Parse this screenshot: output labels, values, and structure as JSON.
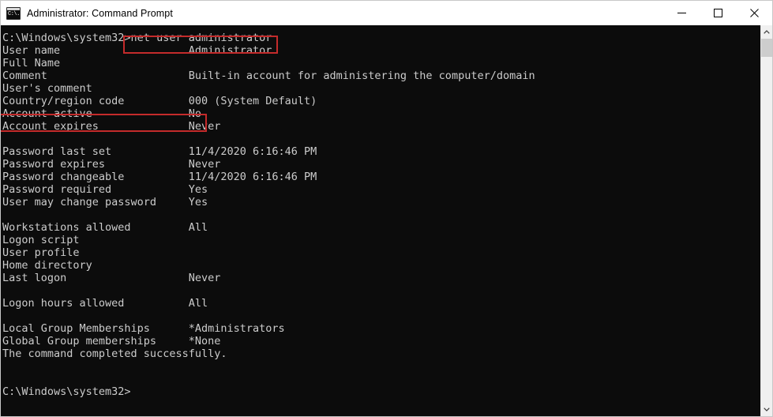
{
  "window": {
    "title": "Administrator: Command Prompt",
    "icon": "command-prompt-icon",
    "icon_glyph": "C:\\.",
    "controls": {
      "minimize": "Minimize",
      "maximize": "Maximize",
      "close": "Close"
    }
  },
  "colors": {
    "terminal_background": "#0c0c0c",
    "terminal_text": "#cccccc",
    "titlebar_background": "#ffffff",
    "titlebar_text": "#000000",
    "annotation_red": "#c42b2b",
    "scrollbar_track": "#f0f0f0",
    "scrollbar_thumb": "#cdcdcd"
  },
  "terminal": {
    "prompt_path": "C:\\Windows\\system32>",
    "command": "net user administrator",
    "output_text": "C:\\Windows\\system32>net user administrator\nUser name                    Administrator\nFull Name\nComment                      Built-in account for administering the computer/domain\nUser's comment\nCountry/region code          000 (System Default)\nAccount active               No\nAccount expires              Never\n\nPassword last set            11/4/2020 6:16:46 PM\nPassword expires             Never\nPassword changeable          11/4/2020 6:16:46 PM\nPassword required            Yes\nUser may change password     Yes\n\nWorkstations allowed         All\nLogon script\nUser profile\nHome directory\nLast logon                   Never\n\nLogon hours allowed          All\n\nLocal Group Memberships      *Administrators\nGlobal Group memberships     *None\nThe command completed successfully.\n\n\nC:\\Windows\\system32>",
    "fields": [
      {
        "label": "User name",
        "value": "Administrator"
      },
      {
        "label": "Full Name",
        "value": ""
      },
      {
        "label": "Comment",
        "value": "Built-in account for administering the computer/domain"
      },
      {
        "label": "User's comment",
        "value": ""
      },
      {
        "label": "Country/region code",
        "value": "000 (System Default)"
      },
      {
        "label": "Account active",
        "value": "No"
      },
      {
        "label": "Account expires",
        "value": "Never"
      },
      {
        "label": "Password last set",
        "value": "11/4/2020 6:16:46 PM"
      },
      {
        "label": "Password expires",
        "value": "Never"
      },
      {
        "label": "Password changeable",
        "value": "11/4/2020 6:16:46 PM"
      },
      {
        "label": "Password required",
        "value": "Yes"
      },
      {
        "label": "User may change password",
        "value": "Yes"
      },
      {
        "label": "Workstations allowed",
        "value": "All"
      },
      {
        "label": "Logon script",
        "value": ""
      },
      {
        "label": "User profile",
        "value": ""
      },
      {
        "label": "Home directory",
        "value": ""
      },
      {
        "label": "Last logon",
        "value": "Never"
      },
      {
        "label": "Logon hours allowed",
        "value": "All"
      },
      {
        "label": "Local Group Memberships",
        "value": "*Administrators"
      },
      {
        "label": "Global Group memberships",
        "value": "*None"
      }
    ],
    "status_line": "The command completed successfully."
  },
  "annotations": [
    {
      "name": "command-highlight",
      "target": "net user administrator"
    },
    {
      "name": "account-active-highlight",
      "target": "Account active               No"
    }
  ],
  "scrollbar": {
    "up_arrow": "scroll-up-icon",
    "down_arrow": "scroll-down-icon",
    "thumb": "scrollbar-thumb"
  }
}
